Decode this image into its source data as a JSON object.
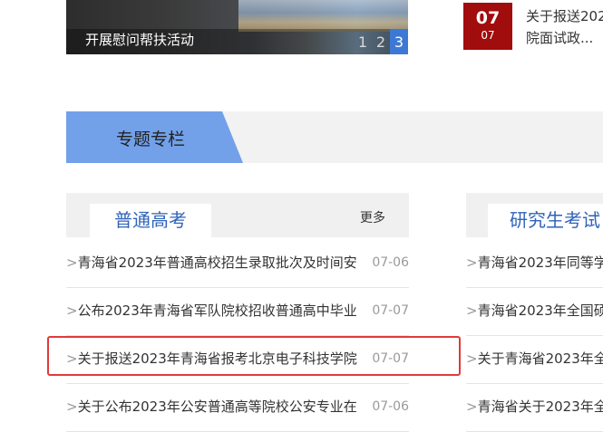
{
  "slideshow": {
    "caption": "开展慰问帮扶活动",
    "pages": [
      "1",
      "2",
      "3"
    ],
    "active_page": "3"
  },
  "top_news": {
    "day": "07",
    "month": "07",
    "title_line1": "关于报送202",
    "title_line2": "院面试政..."
  },
  "section": {
    "title": "专题专栏"
  },
  "left_panel": {
    "title": "普通高考",
    "more": "更多",
    "items": [
      {
        "title": "青海省2023年普通高校招生录取批次及时间安",
        "date": "07-06"
      },
      {
        "title": "公布2023年青海省军队院校招收普通高中毕业",
        "date": "07-07"
      },
      {
        "title": "关于报送2023年青海省报考北京电子科技学院",
        "date": "07-07"
      },
      {
        "title": "关于公布2023年公安普通高等院校公安专业在",
        "date": "07-06"
      }
    ]
  },
  "right_panel": {
    "title": "研究生考试",
    "items": [
      {
        "title": "青海省2023年同等学"
      },
      {
        "title": "青海省2023年全国硕"
      },
      {
        "title": "关于青海省2023年全"
      },
      {
        "title": "青海省关于2023年全"
      }
    ]
  },
  "colors": {
    "accent": "#72a1ea",
    "title_blue": "#2f63b8",
    "date_red": "#a10c0c",
    "highlight": "#e03a3a"
  }
}
